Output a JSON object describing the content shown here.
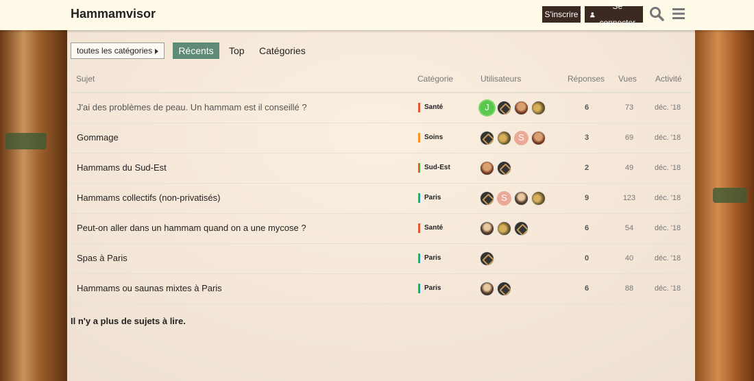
{
  "header": {
    "logo": "Hammamvisor",
    "signup_label": "S'inscrire",
    "login_label": "Se connecter",
    "search_icon": "search-icon",
    "menu_icon": "hamburger-menu-icon"
  },
  "nav": {
    "category_filter": "toutes les catégories",
    "tabs": [
      {
        "label": "Récents",
        "active": true
      },
      {
        "label": "Top",
        "active": false
      },
      {
        "label": "Catégories",
        "active": false
      }
    ],
    "active_color": "#5f8a77"
  },
  "table": {
    "columns": {
      "topic": "Sujet",
      "category": "Catégorie",
      "users": "Utilisateurs",
      "replies": "Réponses",
      "views": "Vues",
      "activity": "Activité"
    },
    "rows": [
      {
        "title": "J'ai des problèmes de peau. Un hammam est il conseillé ?",
        "category": "Santé",
        "category_color": "#e45735",
        "users": [
          "letter-j",
          "gold",
          "photo",
          "leaf"
        ],
        "replies": "6",
        "views": "73",
        "activity": "déc. '18"
      },
      {
        "title": "Gommage",
        "category": "Soins",
        "category_color": "#f7941d",
        "users": [
          "gold",
          "leaf",
          "letter-s",
          "photo"
        ],
        "replies": "3",
        "views": "69",
        "activity": "déc. '18"
      },
      {
        "title": "Hammams du Sud-Est",
        "category": "Sud-Est",
        "category_color": "#3ab54a",
        "users": [
          "photo",
          "gold"
        ],
        "replies": "2",
        "views": "49",
        "activity": "déc. '18"
      },
      {
        "title": "Hammams collectifs (non-privatisés)",
        "category": "Paris",
        "category_color": "#1c91c4",
        "users": [
          "gold",
          "letter-s",
          "photo2",
          "leaf"
        ],
        "replies": "9",
        "views": "123",
        "activity": "déc. '18"
      },
      {
        "title": "Peut-on aller dans un hammam quand on a une mycose ?",
        "category": "Santé",
        "category_color": "#e45735",
        "users": [
          "photo2",
          "leaf",
          "gold"
        ],
        "replies": "6",
        "views": "54",
        "activity": "déc. '18"
      },
      {
        "title": "Spas à Paris",
        "category": "Paris",
        "category_color": "#1c91c4",
        "users": [
          "gold"
        ],
        "replies": "0",
        "views": "40",
        "activity": "déc. '18"
      },
      {
        "title": "Hammams ou saunas mixtes à Paris",
        "category": "Paris",
        "category_color": "#1c91c4",
        "users": [
          "photo2",
          "gold"
        ],
        "replies": "6",
        "views": "88",
        "activity": "déc. '18"
      }
    ]
  },
  "footer_note": "Il n'y a plus de sujets à lire."
}
